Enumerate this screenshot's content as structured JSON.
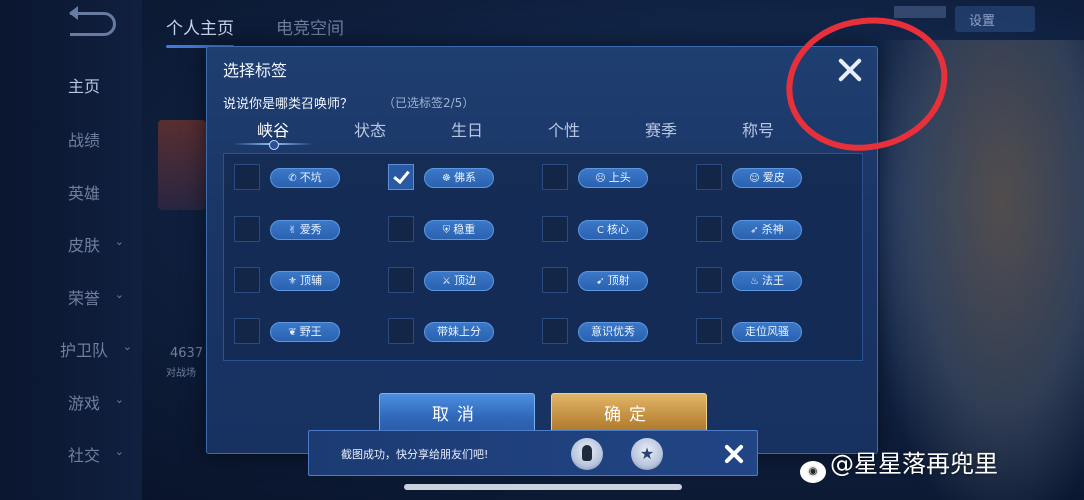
{
  "background": {
    "top_tabs": [
      "个人主页",
      "电竞空间"
    ],
    "settings_label": "设置",
    "nav_items": [
      {
        "label": "主页",
        "chevron": false
      },
      {
        "label": "战绩",
        "chevron": false
      },
      {
        "label": "英雄",
        "chevron": false
      },
      {
        "label": "皮肤",
        "chevron": true
      },
      {
        "label": "荣誉",
        "chevron": true
      },
      {
        "label": "护卫队",
        "chevron": true
      },
      {
        "label": "游戏",
        "chevron": true
      },
      {
        "label": "社交",
        "chevron": true
      }
    ],
    "stat_number": "4637",
    "stat_caption": "对战场"
  },
  "dialog": {
    "title": "选择标签",
    "question": "说说你是哪类召唤师？",
    "selected_count": "（已选标签2/5）",
    "tabs": [
      "峡谷",
      "状态",
      "生日",
      "个性",
      "赛季",
      "称号"
    ],
    "active_tab": 0,
    "options": [
      [
        {
          "label": "不坑",
          "icon": "phone-icon",
          "glyph": "✆",
          "checked": false
        },
        {
          "label": "佛系",
          "icon": "buddha-icon",
          "glyph": "☸",
          "checked": true
        },
        {
          "label": "上头",
          "icon": "face-icon",
          "glyph": "☹",
          "checked": false
        },
        {
          "label": "爱皮",
          "icon": "cat-icon",
          "glyph": "☺",
          "checked": false
        }
      ],
      [
        {
          "label": "爱秀",
          "icon": "victory-hand-icon",
          "glyph": "✌",
          "checked": false
        },
        {
          "label": "稳重",
          "icon": "shield-icon",
          "glyph": "⛨",
          "checked": false
        },
        {
          "label": "核心",
          "icon": "c-core-icon",
          "glyph": "C",
          "checked": false
        },
        {
          "label": "杀神",
          "icon": "blade-icon",
          "glyph": "➶",
          "checked": false
        }
      ],
      [
        {
          "label": "顶辅",
          "icon": "support-icon",
          "glyph": "⚜",
          "checked": false
        },
        {
          "label": "顶边",
          "icon": "crossed-swords-icon",
          "glyph": "⚔",
          "checked": false
        },
        {
          "label": "顶射",
          "icon": "archer-icon",
          "glyph": "➹",
          "checked": false
        },
        {
          "label": "法王",
          "icon": "flame-icon",
          "glyph": "♨",
          "checked": false
        }
      ],
      [
        {
          "label": "野王",
          "icon": "jungle-icon",
          "glyph": "❦",
          "checked": false
        },
        {
          "label": "带妹上分",
          "icon": "",
          "glyph": "",
          "checked": false
        },
        {
          "label": "意识优秀",
          "icon": "",
          "glyph": "",
          "checked": false
        },
        {
          "label": "走位风骚",
          "icon": "",
          "glyph": "",
          "checked": false
        }
      ]
    ],
    "cancel_label": "取消",
    "confirm_label": "确定"
  },
  "toast": {
    "text": "截图成功，快分享给朋友们吧!",
    "share_icons": [
      "qq-icon",
      "qzone-icon"
    ]
  },
  "watermark": "@星星落再兜里",
  "colors": {
    "annotation_circle": "#e8303b",
    "confirm_gold": "#c18d3e",
    "cancel_blue": "#2f67b8",
    "tag_blue": "#2a62b0"
  }
}
